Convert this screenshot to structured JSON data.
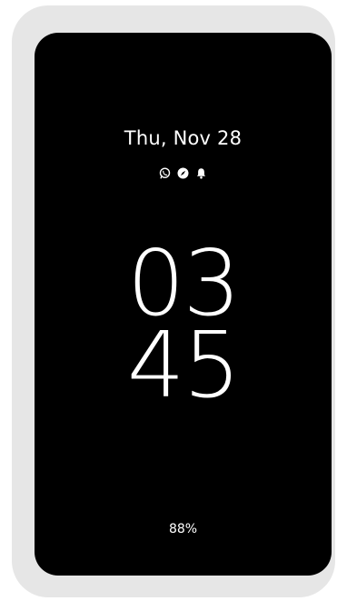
{
  "lock_screen": {
    "date": "Thu, Nov 28",
    "notification_icons": [
      "whatsapp-icon",
      "compass-icon",
      "bell-icon"
    ],
    "clock_hours": "03",
    "clock_minutes": "45",
    "battery": "88%"
  },
  "colors": {
    "frame": "#e6e6e6",
    "screen": "#000000",
    "text": "#ffffff"
  }
}
